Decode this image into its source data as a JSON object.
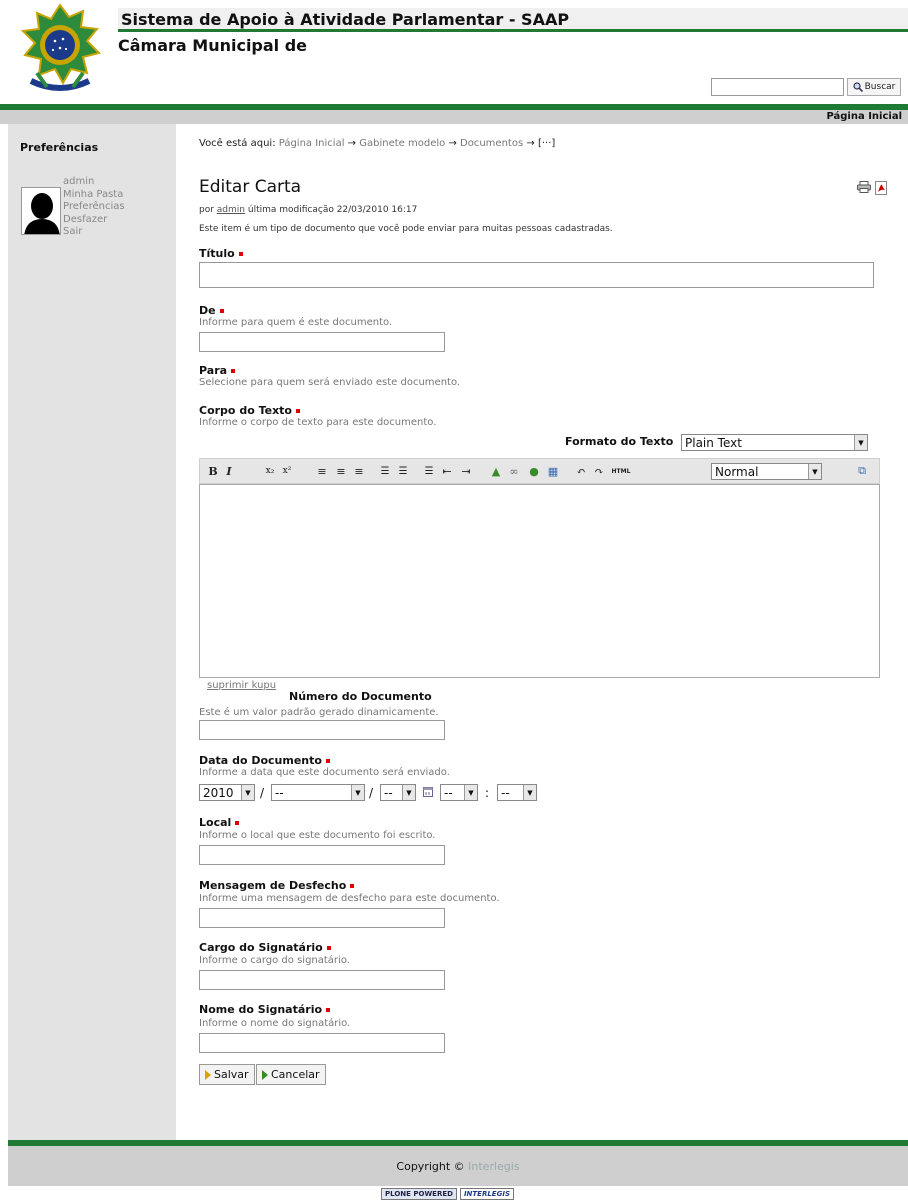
{
  "header": {
    "system_title": "Sistema de Apoio à Atividade Parlamentar - SAAP",
    "subtitle": "Câmara Municipal de",
    "search_placeholder": "",
    "search_button": "Buscar"
  },
  "nav": {
    "home": "Página Inicial"
  },
  "sidebar": {
    "title": "Preferências",
    "user_links": [
      "admin",
      "Minha Pasta",
      "Preferências",
      "Desfazer",
      "Sair"
    ]
  },
  "breadcrumb": {
    "prefix": "Você está aqui:",
    "items": [
      "Página Inicial",
      "Gabinete modelo",
      "Documentos"
    ],
    "arrow": "→",
    "last": "[···]"
  },
  "page": {
    "title": "Editar Carta",
    "byline_prefix": "por",
    "author": "admin",
    "modified": "última modificação 22/03/2010 16:17",
    "description": "Este item é um tipo de documento que você pode enviar para muitas pessoas cadastradas."
  },
  "form": {
    "titulo": {
      "label": "Título",
      "value": ""
    },
    "de": {
      "label": "De",
      "help": "Informe para quem é este documento.",
      "value": ""
    },
    "para": {
      "label": "Para",
      "help": "Selecione para quem será enviado este documento."
    },
    "corpo": {
      "label": "Corpo do Texto",
      "help": "Informe o corpo de texto para este documento."
    },
    "formato": {
      "label": "Formato do Texto",
      "value": "Plain Text"
    },
    "editor": {
      "style_value": "Normal",
      "html_label": "HTML",
      "suprimir": "suprimir kupu"
    },
    "numero": {
      "label": "Número do Documento",
      "help": "Este é um valor padrão gerado dinamicamente.",
      "value": ""
    },
    "data": {
      "label": "Data do Documento",
      "help": "Informe a data que este documento será enviado.",
      "year": "2010",
      "month": "--",
      "day": "--",
      "hour": "--",
      "minute": "--",
      "sep_slash": "/",
      "sep_colon": ":"
    },
    "local": {
      "label": "Local",
      "help": "Informe o local que este documento foi escrito.",
      "value": ""
    },
    "mensagem": {
      "label": "Mensagem de Desfecho",
      "help": "Informe uma mensagem de desfecho para este documento.",
      "value": ""
    },
    "cargo": {
      "label": "Cargo do Signatário",
      "help": "Informe o cargo do signatário.",
      "value": ""
    },
    "nome": {
      "label": "Nome do Signatário",
      "help": "Informe o nome do signatário.",
      "value": ""
    },
    "buttons": {
      "save": "Salvar",
      "cancel": "Cancelar"
    }
  },
  "footer": {
    "copyright": "Copyright ©",
    "owner": "Interlegis",
    "badges": [
      "PLONE POWERED",
      "INTERLEGIS"
    ]
  },
  "colors": {
    "accent_green": "#1f7a34",
    "nav_grey": "#cfcfcf",
    "sidebar_grey": "#e3e3e3",
    "required_red": "#dd0000"
  }
}
